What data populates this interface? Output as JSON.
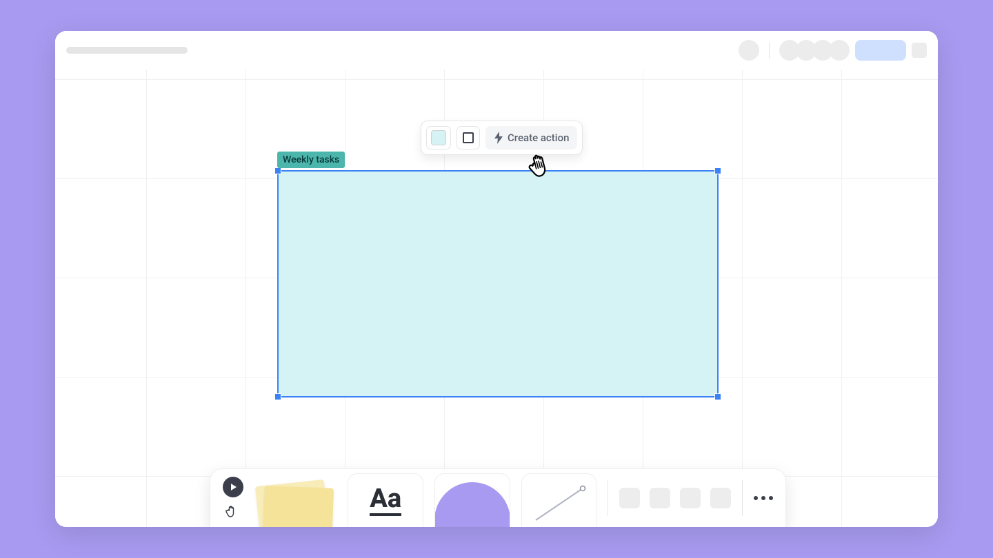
{
  "shape": {
    "label": "Weekly tasks",
    "fill": "#d5f3f4"
  },
  "context_toolbar": {
    "create_action_label": "Create action"
  },
  "bottom_toolbar": {
    "text_label": "Aa"
  }
}
